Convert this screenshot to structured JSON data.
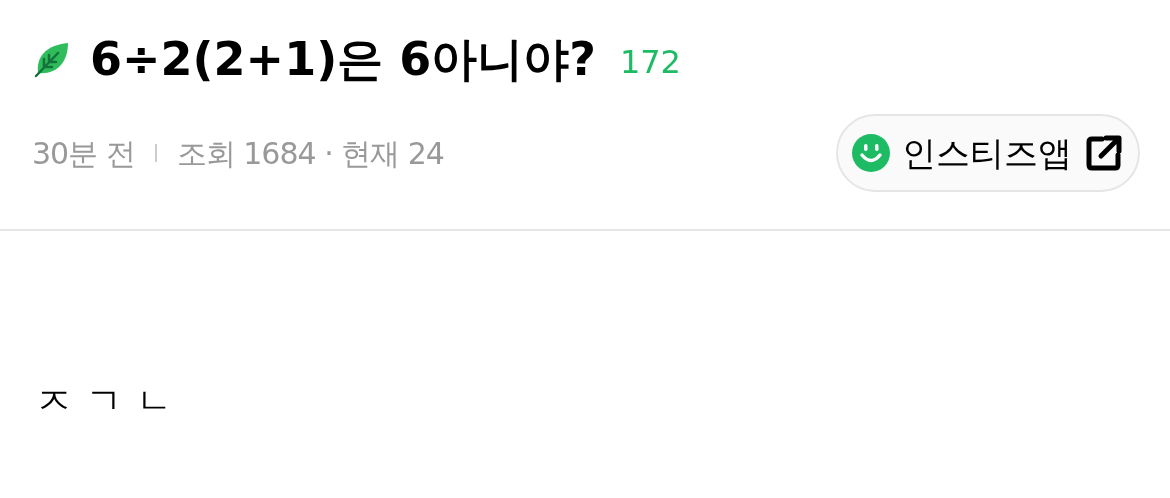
{
  "post": {
    "title": "6÷2(2+1)은 6아니야?",
    "comment_count": "172",
    "time": "30분 전",
    "views": "조회 1684 · 현재 24",
    "app_button": {
      "label": "인스티즈앱"
    },
    "body": "ㅈㄱㄴ"
  }
}
